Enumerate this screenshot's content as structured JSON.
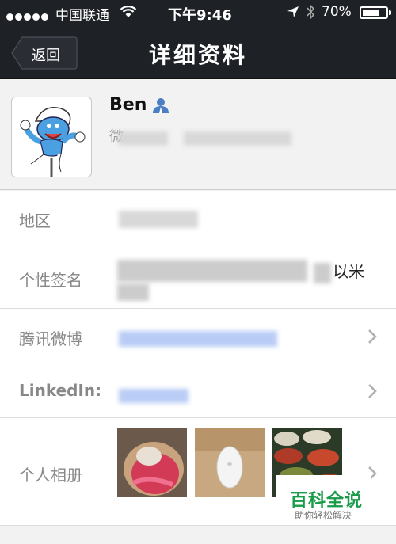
{
  "status_bar": {
    "carrier": "中国联通",
    "time": "下午9:46",
    "battery_text": "70%",
    "battery_level": 0.7
  },
  "nav": {
    "back_label": "返回",
    "title": "详细资料"
  },
  "profile": {
    "name": "Ben",
    "wechat_id_prefix": "微",
    "avatar": "smurf-avatar"
  },
  "rows": {
    "region_label": "地区",
    "signature_label": "个性签名",
    "signature_tail": "以米",
    "weibo_label": "腾讯微博",
    "linkedin_label": "LinkedIn:",
    "album_label": "个人相册"
  },
  "watermark": {
    "title": "百科全说",
    "subtitle": "助你轻松解决"
  },
  "colors": {
    "nav_bg": "#1e2126",
    "link_blue": "#8fb0ff",
    "watermark_green": "#1a9b4a"
  }
}
